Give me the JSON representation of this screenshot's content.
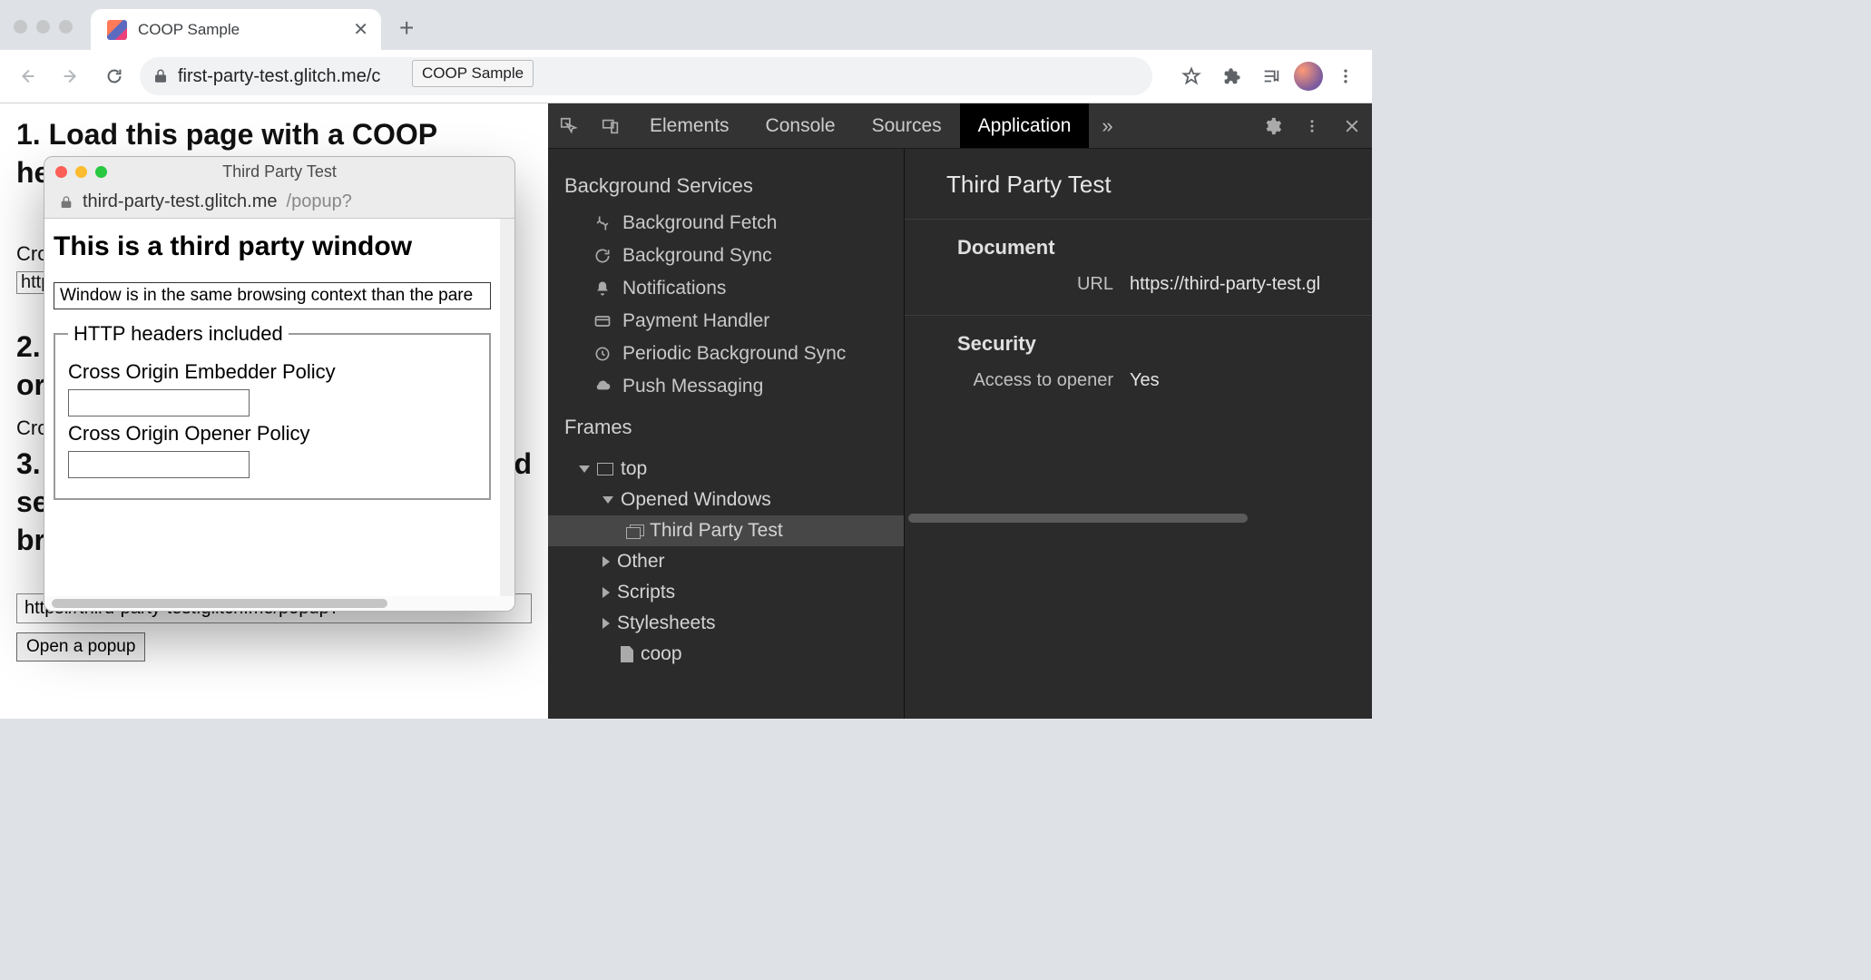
{
  "browser": {
    "tab_title": "COOP Sample",
    "url": "first-party-test.glitch.me/c",
    "url_tooltip": "COOP Sample"
  },
  "page": {
    "h1_line1": "1. Load this page with a COOP",
    "h1_line2": "he",
    "cro_fragment": "Cro",
    "http_fragment": "http",
    "h2_line1": "2.",
    "h2_line2": "or",
    "cro_fragment2": "Cro",
    "h3_line1": "3.",
    "h3_char_d": "d",
    "h3_line2": "se",
    "h3_line3": "br",
    "popup_url_value": "https://third-party-test.glitch.me/popup?",
    "open_popup_btn": "Open a popup"
  },
  "popup": {
    "title": "Third Party Test",
    "host": "third-party-test.glitch.me",
    "path": "/popup?",
    "heading": "This is a third party window",
    "status_text": "Window is in the same browsing context than the pare",
    "fieldset_legend": "HTTP headers included",
    "coep_label": "Cross Origin Embedder Policy",
    "coep_value": "",
    "coop_label": "Cross Origin Opener Policy",
    "coop_value": ""
  },
  "devtools": {
    "tabs": [
      "Elements",
      "Console",
      "Sources",
      "Application"
    ],
    "active_tab": "Application",
    "overflow": "»",
    "sidebar": {
      "bg_services_title": "Background Services",
      "bg_services": [
        "Background Fetch",
        "Background Sync",
        "Notifications",
        "Payment Handler",
        "Periodic Background Sync",
        "Push Messaging"
      ],
      "frames_title": "Frames",
      "frames": {
        "top": "top",
        "opened_windows": "Opened Windows",
        "third_party": "Third Party Test",
        "other": "Other",
        "scripts": "Scripts",
        "stylesheets": "Stylesheets",
        "coop": "coop"
      }
    },
    "detail": {
      "title": "Third Party Test",
      "document_section": "Document",
      "url_label": "URL",
      "url_value": "https://third-party-test.gl",
      "security_section": "Security",
      "opener_label": "Access to opener",
      "opener_value": "Yes"
    }
  }
}
